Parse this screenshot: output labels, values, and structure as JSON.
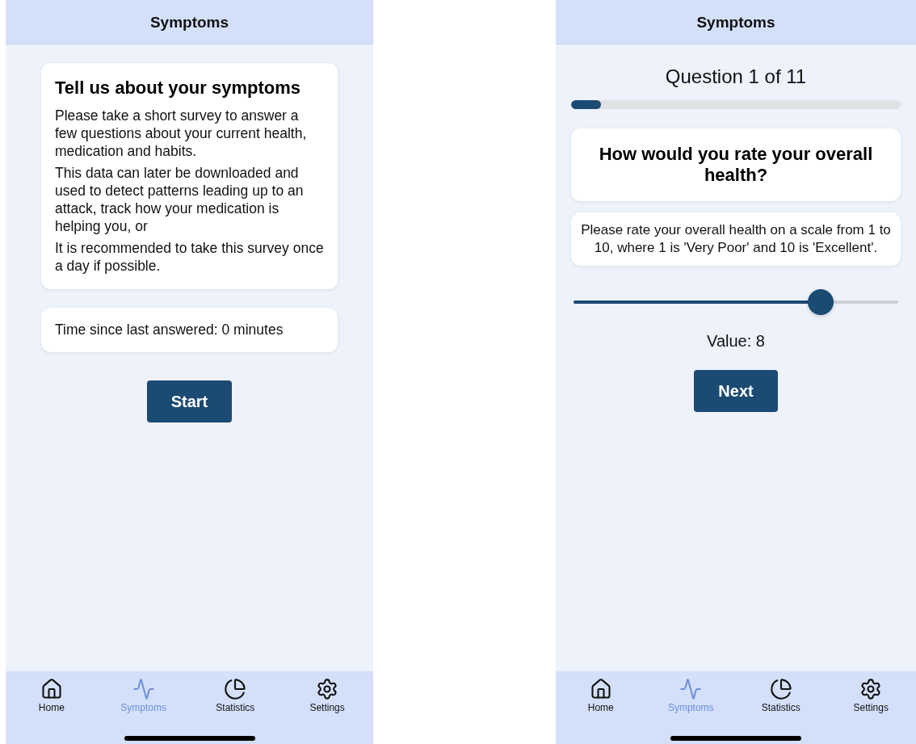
{
  "screens": [
    {
      "kind": "intro",
      "header": "Symptoms",
      "card": {
        "title": "Tell us about your symptoms",
        "paragraphs": [
          "Please take a short survey to answer a few questions about your current health, medication and habits.",
          "This data can later be downloaded and used to detect patterns leading up to an attack, track how your medication is helping you, or",
          "It is recommended to take this survey once a day if possible."
        ]
      },
      "status": "Time since last answered: 0 minutes",
      "button": "Start",
      "tabs": [
        {
          "label": "Home",
          "selected": false
        },
        {
          "label": "Symptoms",
          "selected": true
        },
        {
          "label": "Statistics",
          "selected": false
        },
        {
          "label": "Settings",
          "selected": false
        }
      ]
    },
    {
      "kind": "question",
      "header": "Symptoms",
      "counter": "Question 1 of 11",
      "progress": {
        "level": 0.09
      },
      "question": "How would you rate your overall health?",
      "description": "Please rate your overall health on a scale from 1 to 10, where 1 is 'Very Poor' and 10 is 'Excellent'.",
      "slider": {
        "level": 0.76
      },
      "value": "Value: 8",
      "button": "Next",
      "tabs": [
        {
          "label": "Home",
          "selected": false
        },
        {
          "label": "Symptoms",
          "selected": true
        },
        {
          "label": "Statistics",
          "selected": false
        },
        {
          "label": "Settings",
          "selected": false
        }
      ]
    }
  ]
}
